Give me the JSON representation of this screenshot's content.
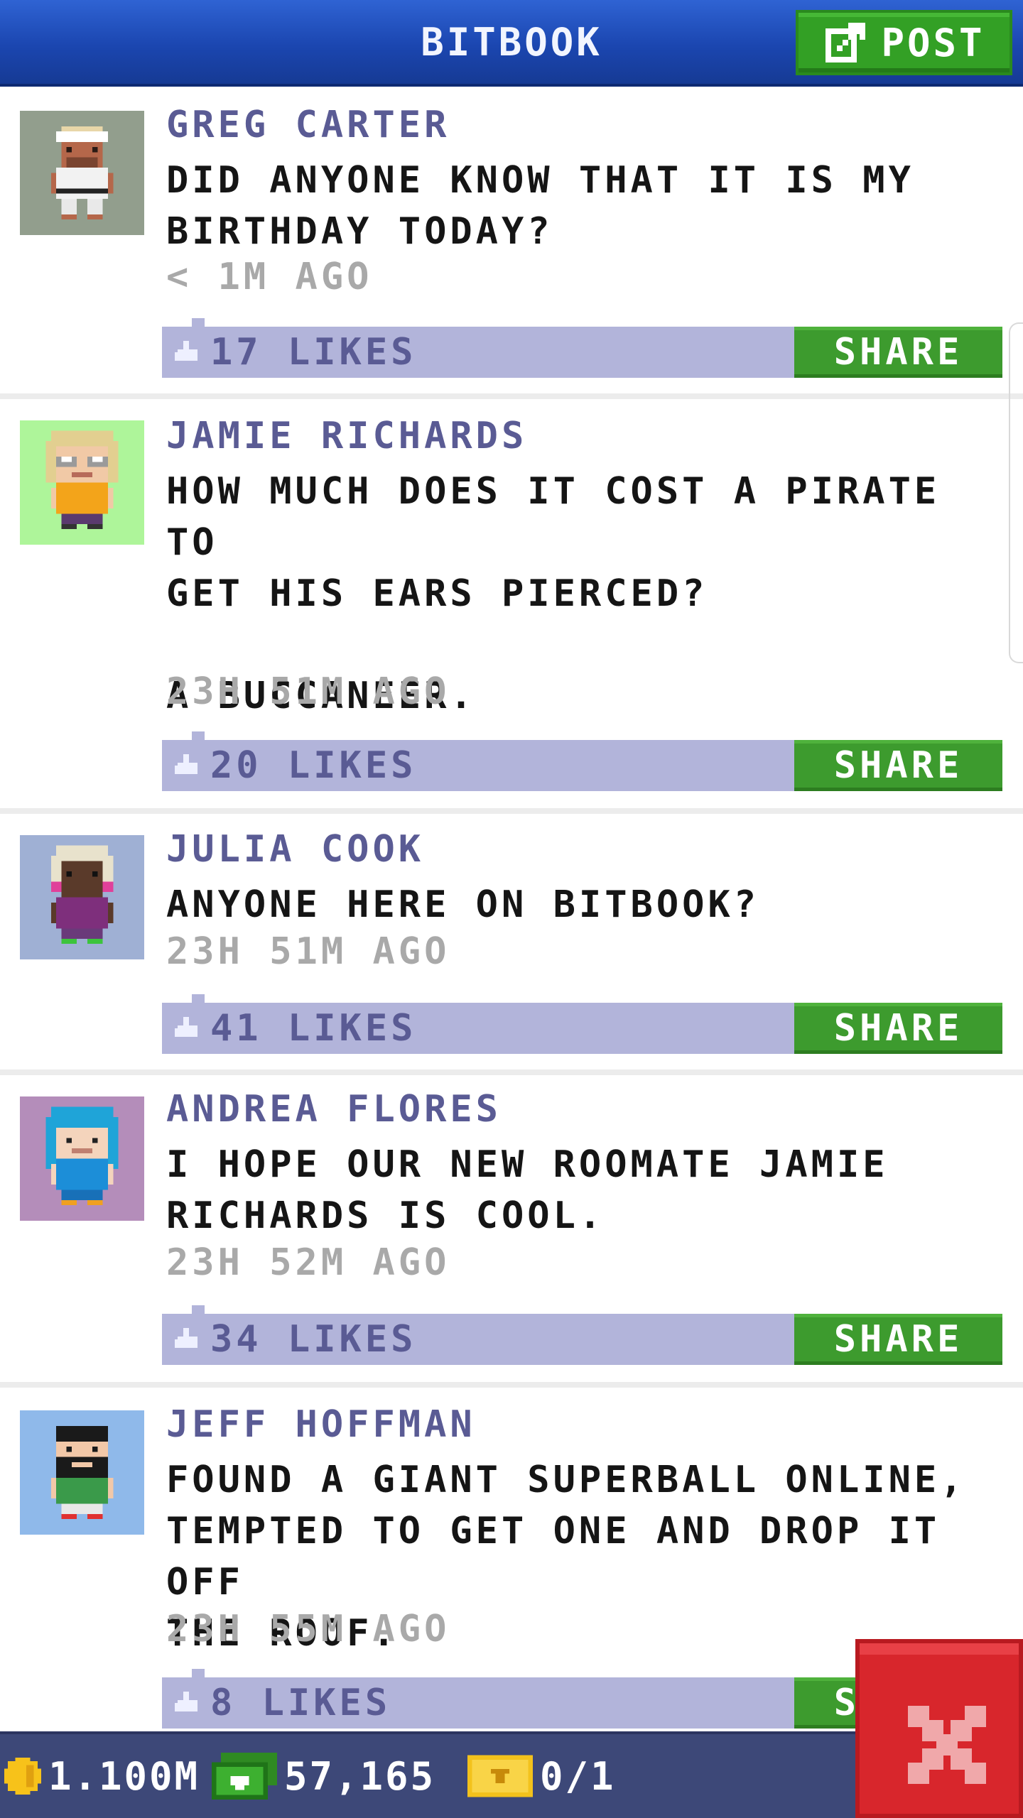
{
  "header": {
    "title": "BITBOOK",
    "post_label": "POST"
  },
  "posts": [
    {
      "author": "GREG CARTER",
      "text": "DID ANYONE KNOW THAT IT IS MY\nBIRTHDAY TODAY?",
      "time": "< 1M AGO",
      "likes": "17 LIKES",
      "share_label": "SHARE",
      "avatar_bg": "#929e8d"
    },
    {
      "author": "JAMIE RICHARDS",
      "text": "HOW MUCH DOES IT COST A PIRATE TO\nGET HIS EARS PIERCED?\n\nA BUCCANEER.",
      "time": "23H 51M AGO",
      "likes": "20 LIKES",
      "share_label": "SHARE",
      "avatar_bg": "#aef59a"
    },
    {
      "author": "JULIA COOK",
      "text": "ANYONE HERE ON BITBOOK?",
      "time": "23H 51M AGO",
      "likes": "41 LIKES",
      "share_label": "SHARE",
      "avatar_bg": "#9fb0d4"
    },
    {
      "author": "ANDREA FLORES",
      "text": "I HOPE OUR NEW ROOMATE JAMIE\nRICHARDS IS COOL.",
      "time": "23H 52M AGO",
      "likes": "34 LIKES",
      "share_label": "SHARE",
      "avatar_bg": "#b48dba"
    },
    {
      "author": "JEFF HOFFMAN",
      "text": "FOUND A GIANT SUPERBALL ONLINE,\nTEMPTED TO GET ONE AND DROP IT OFF\nTHE ROOF.",
      "time": "23H 55M AGO",
      "likes": "8 LIKES",
      "share_label": "SHARE",
      "avatar_bg": "#8fb9ea"
    }
  ],
  "status_bar": {
    "coins": "1.100M",
    "bux": "57,165",
    "tickets": "0/1"
  },
  "colors": {
    "header_blue": "#1b46b0",
    "accent_green": "#3d9b2e",
    "like_bar": "#b2b4da",
    "name_purple": "#5a5b94",
    "close_red": "#d8262c"
  },
  "icons": {
    "post": "edit-icon",
    "like": "thumbs-up-icon",
    "coin": "coin-icon",
    "bux": "bux-icon",
    "ticket": "ticket-icon",
    "close": "close-icon"
  }
}
